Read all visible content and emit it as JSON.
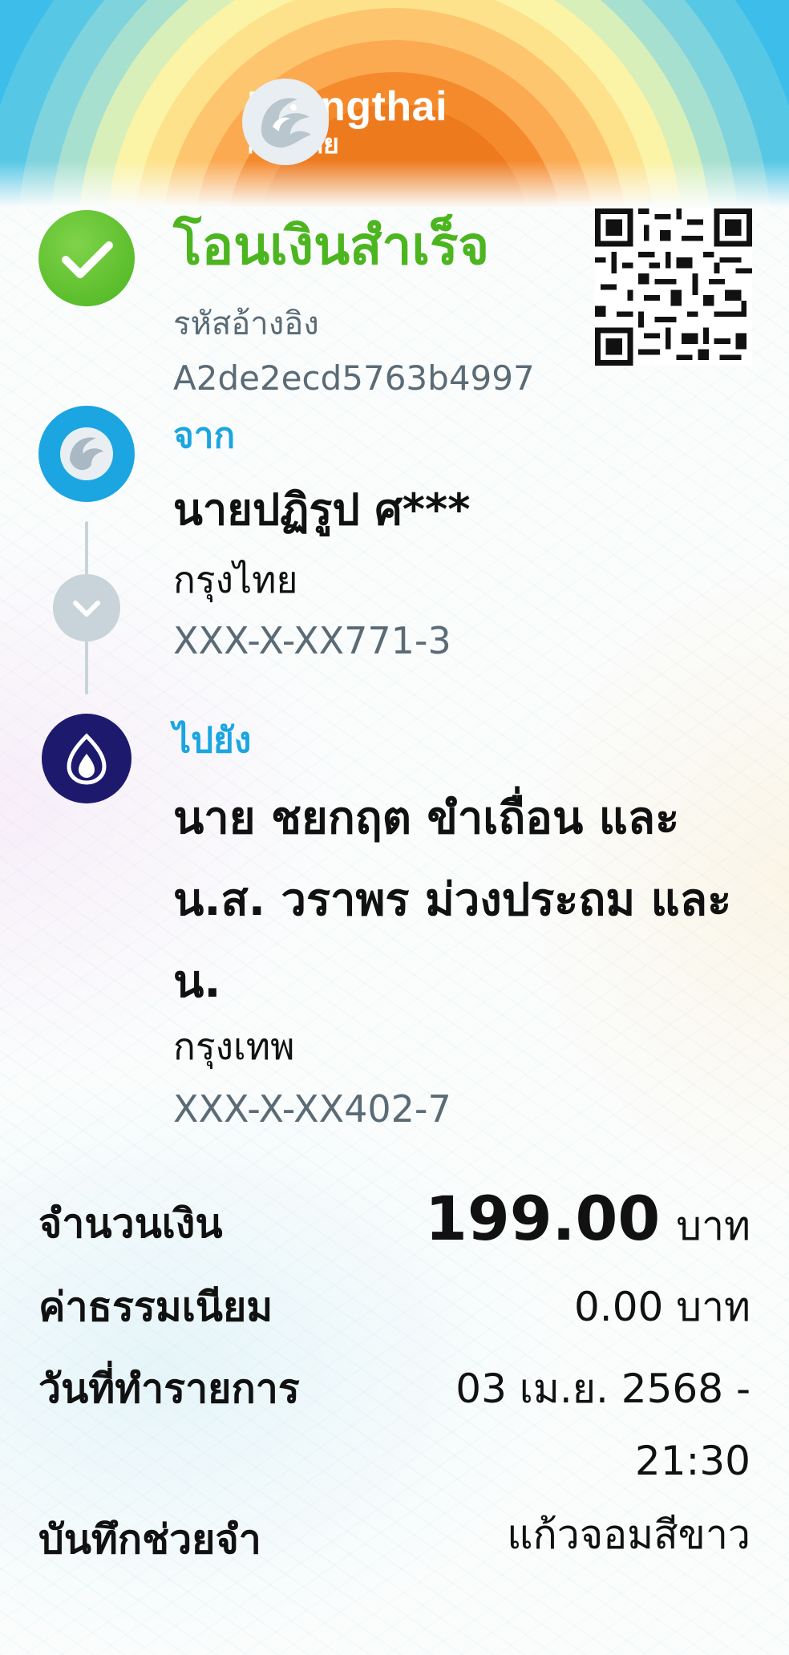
{
  "brand": {
    "name": "Krungthai",
    "name_thai": "กรุงไทย"
  },
  "status": {
    "title": "โอนเงินสำเร็จ",
    "ref_label": "รหัสอ้างอิง",
    "ref_code": "A2de2ecd5763b4997",
    "icon": "check-icon"
  },
  "from": {
    "label": "จาก",
    "name": "นายปฏิรูป ศ***",
    "bank": "กรุงไทย",
    "account": "XXX-X-XX771-3"
  },
  "to": {
    "label": "ไปยัง",
    "name": "นาย ชยกฤต ขำเถื่อน และ น.ส. วราพร ม่วงประถม และ น.",
    "bank": "กรุงเทพ",
    "account": "XXX-X-XX402-7"
  },
  "details": {
    "amount_label": "จำนวนเงิน",
    "amount_value": "199.00",
    "amount_unit": "บาท",
    "fee_label": "ค่าธรรมเนียม",
    "fee_value": "0.00 บาท",
    "date_label": "วันที่ทำรายการ",
    "date_line1": "03 เม.ย. 2568 -",
    "date_line2": "21:30",
    "memo_label": "บันทึกช่วยจำ",
    "memo_value": "แก้วจอมสีขาว"
  },
  "colors": {
    "success": "#4cb51f",
    "accent_blue": "#1ba5e1",
    "bbl_navy": "#1d1a6e",
    "muted": "#5b6b76"
  }
}
